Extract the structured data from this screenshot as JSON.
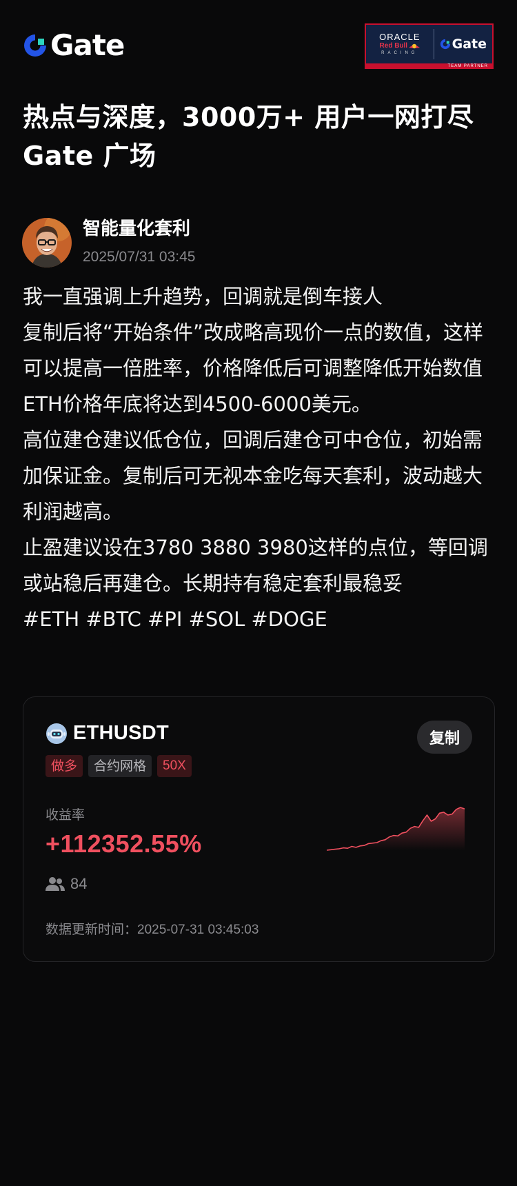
{
  "brand": {
    "name": "Gate",
    "accent": "#2354e6",
    "partner": {
      "oracle": "ORACLE",
      "redbull": "Red Bull",
      "racing": "RACING",
      "gate": "Gate",
      "team_partner": "TEAM PARTNER",
      "bg_color": "#132242",
      "border_color": "#c8102e"
    }
  },
  "headline": {
    "line1": "热点与深度，3000万+ 用户一网打尽",
    "line2": "Gate 广场"
  },
  "author": {
    "name": "智能量化套利",
    "timestamp": "2025/07/31 03:45",
    "avatar_icon": "avatar-photo"
  },
  "post": {
    "paragraphs": [
      "我一直强调上升趋势，回调就是倒车接人",
      "复制后将“开始条件”改成略高现价一点的数值，这样可以提高一倍胜率，价格降低后可调整降低开始数值",
      "ETH价格年底将达到4500-6000美元。",
      "高位建仓建议低仓位，回调后建仓可中仓位，初始需加保证金。复制后可无视本金吃每天套利，波动越大利润越高。",
      "止盈建议设在3780 3880 3980这样的点位，等回调或站稳后再建仓。长期持有稳定套利最稳妥"
    ],
    "hashtags": "#ETH #BTC #PI #SOL #DOGE"
  },
  "strategy_card": {
    "pair": "ETHUSDT",
    "pair_icon": "robot-icon",
    "copy_label": "复制",
    "tags": {
      "direction": "做多",
      "type": "合约网格",
      "leverage": "50X"
    },
    "yield_label": "收益率",
    "yield_value": "+112352.55%",
    "followers_icon": "users-icon",
    "followers": "84",
    "update_label": "数据更新时间：",
    "update_time": "2025-07-31 03:45:03",
    "positive_color": "#f0505f"
  },
  "chart_data": {
    "type": "area",
    "title": "",
    "xlabel": "",
    "ylabel": "",
    "values": [
      2,
      2.1,
      2.2,
      2.3,
      2.5,
      2.4,
      2.8,
      2.6,
      2.9,
      3.0,
      3.4,
      3.5,
      3.6,
      4.0,
      4.2,
      4.8,
      5.1,
      5.0,
      5.6,
      5.8,
      6.6,
      7.0,
      6.8,
      8.2,
      9.4,
      8.1,
      8.6,
      9.8,
      10.0,
      9.4,
      9.6,
      10.6,
      11.0,
      10.7
    ],
    "color": "#f0505f",
    "grid": false,
    "legend": "none"
  }
}
